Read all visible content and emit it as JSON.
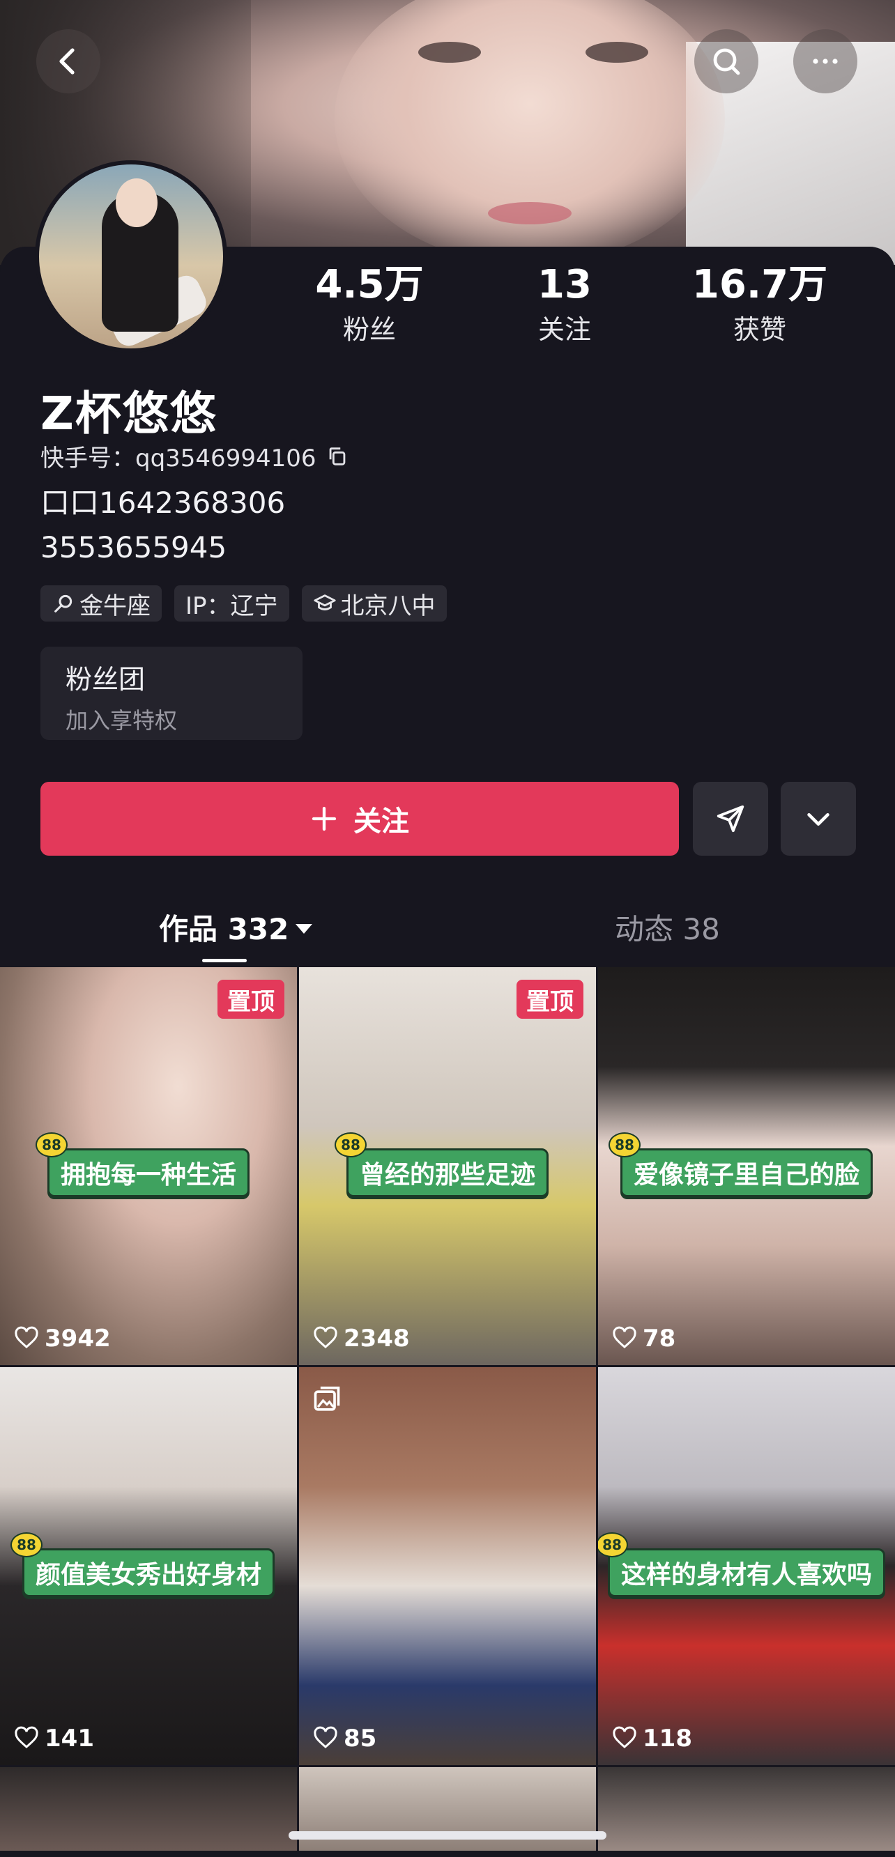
{
  "header": {
    "back_icon": "chevron-left-icon",
    "search_icon": "search-icon",
    "more_icon": "more-dots-icon"
  },
  "stats": [
    {
      "num": "4.5万",
      "label": "粉丝"
    },
    {
      "num": "13",
      "label": "关注"
    },
    {
      "num": "16.7万",
      "label": "获赞"
    }
  ],
  "profile": {
    "name": "Z杯悠悠",
    "kuaishou_id": "快手号：qq3546994106",
    "bio_line1": "口口1642368306",
    "bio_line2": "3553655945"
  },
  "tags": [
    {
      "icon": "search-small-icon",
      "text": "金牛座"
    },
    {
      "icon": "",
      "text": "IP：辽宁"
    },
    {
      "icon": "graduation-cap-icon",
      "text": "北京八中"
    }
  ],
  "fan_club": {
    "title": "粉丝团",
    "subtitle": "加入享特权"
  },
  "actions": {
    "follow_label": "关注",
    "accent": "#e3395a"
  },
  "tabs": {
    "works": "作品 332",
    "moments": "动态 38"
  },
  "videos": [
    {
      "pinned": "置顶",
      "caption": "拥抱每一种生活",
      "likes": "3942"
    },
    {
      "pinned": "置顶",
      "caption": "曾经的那些足迹",
      "likes": "2348"
    },
    {
      "pinned": "",
      "caption": "爱像镜子里自己的脸",
      "likes": "78"
    },
    {
      "pinned": "",
      "caption": "颜值美女秀出好身材",
      "likes": "141"
    },
    {
      "pinned": "",
      "caption": "",
      "likes": "85"
    },
    {
      "pinned": "",
      "caption": "这样的身材有人喜欢吗",
      "likes": "118"
    }
  ]
}
